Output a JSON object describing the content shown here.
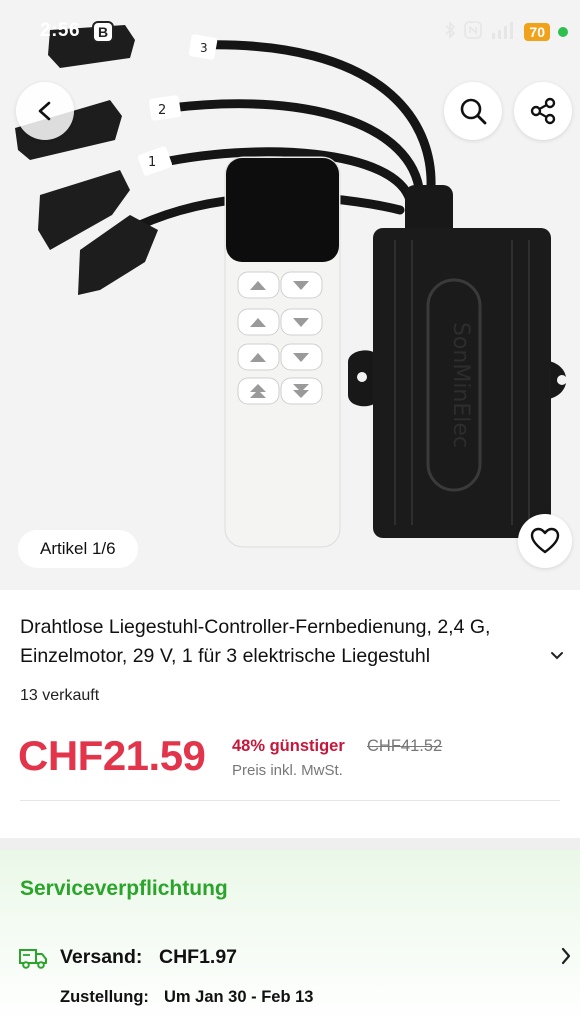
{
  "status_bar": {
    "time": "2:56",
    "b_badge": "B",
    "battery": "70"
  },
  "hero": {
    "image_description_icon": "product-image-icon",
    "device_logo": "SonMinElec",
    "cable_labels": [
      "1",
      "2",
      "3"
    ],
    "article_counter": "Artikel 1/6"
  },
  "product": {
    "title": "Drahtlose Liegestuhl-Controller-Fernbedienung, 2,4 G, Einzelmotor, 29 V, 1 für 3 elektrische Liegestuhl",
    "sold": "13 verkauft",
    "price": "CHF21.59",
    "discount": "48% günstiger",
    "old_price": "CHF41.52",
    "tax_note": "Preis inkl. MwSt."
  },
  "service": {
    "title": "Serviceverpflichtung",
    "shipping_label": "Versand:",
    "shipping_price": "CHF1.97",
    "delivery_label": "Zustellung:",
    "delivery_value": "Um Jan 30 - Feb 13"
  },
  "colors": {
    "price_red": "#e2344a",
    "discount_red": "#c8163a",
    "service_green": "#2aa52a",
    "battery_orange": "#f0a21a"
  }
}
